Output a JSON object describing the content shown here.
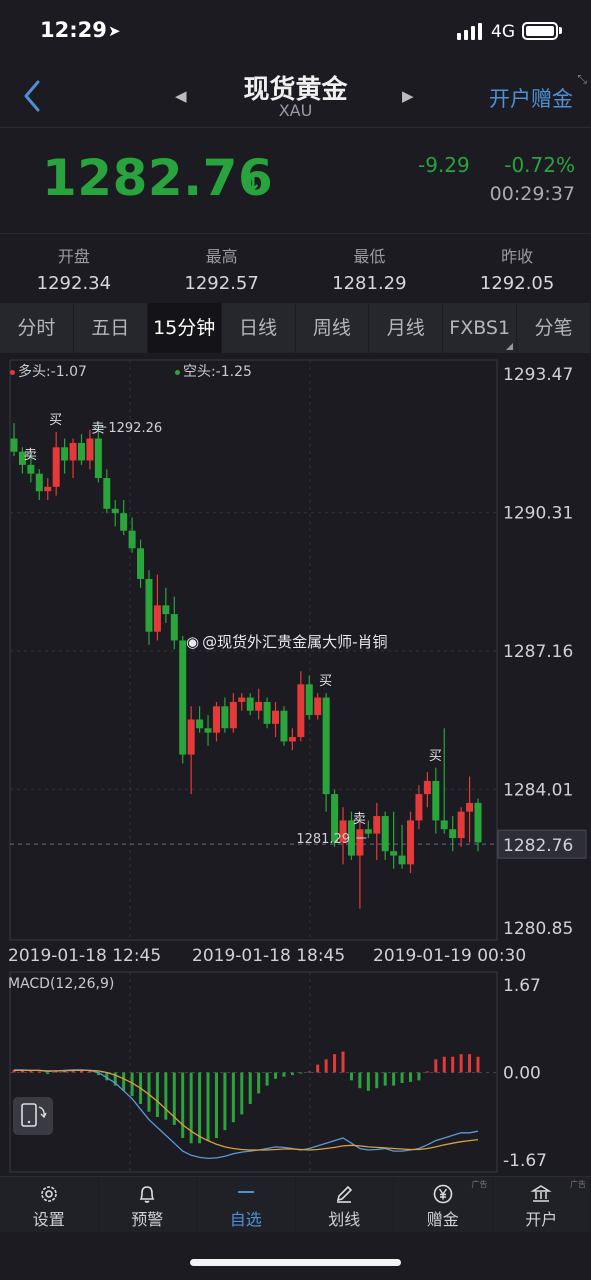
{
  "status_bar": {
    "time": "12:29",
    "network": "4G"
  },
  "header": {
    "title": "现货黄金",
    "subtitle": "XAU",
    "open_account": "开户赠金"
  },
  "quote": {
    "price": "1282.76",
    "change": "-9.29",
    "change_pct": "-0.72%",
    "time": "00:29:37"
  },
  "stats": [
    {
      "label": "开盘",
      "value": "1292.34"
    },
    {
      "label": "最高",
      "value": "1292.57"
    },
    {
      "label": "最低",
      "value": "1281.29"
    },
    {
      "label": "昨收",
      "value": "1292.05"
    }
  ],
  "tabs": [
    {
      "label": "分时",
      "active": false,
      "dropdown": false
    },
    {
      "label": "五日",
      "active": false,
      "dropdown": false
    },
    {
      "label": "15分钟",
      "active": true,
      "dropdown": false
    },
    {
      "label": "日线",
      "active": false,
      "dropdown": false
    },
    {
      "label": "周线",
      "active": false,
      "dropdown": false
    },
    {
      "label": "月线",
      "active": false,
      "dropdown": false
    },
    {
      "label": "FXBS1",
      "active": false,
      "dropdown": true
    },
    {
      "label": "分笔",
      "active": false,
      "dropdown": false
    }
  ],
  "legend": {
    "long": "多头:-1.07",
    "short": "空头:-1.25"
  },
  "watermark": "@现货外汇贵金属大师-肖铜",
  "macd_label": "MACD(12,26,9)",
  "bottom_bar": [
    {
      "label": "设置",
      "icon": "gear-icon",
      "active": false,
      "ad": false
    },
    {
      "label": "预警",
      "icon": "bell-icon",
      "active": false,
      "ad": false
    },
    {
      "label": "自选",
      "icon": "dash-icon",
      "active": true,
      "ad": false
    },
    {
      "label": "划线",
      "icon": "pen-icon",
      "active": false,
      "ad": false
    },
    {
      "label": "赠金",
      "icon": "yen-icon",
      "active": false,
      "ad": true
    },
    {
      "label": "开户",
      "icon": "bank-icon",
      "active": false,
      "ad": true
    }
  ],
  "ad_tag": "广告",
  "colors": {
    "up": "#e63a3a",
    "down": "#2aa53c",
    "accent": "#4e8fd6",
    "dif": "#5a9ad8",
    "dea": "#d8a040"
  },
  "chart_data": {
    "type": "candlestick",
    "y_ticks": [
      "1293.47",
      "1290.31",
      "1287.16",
      "1284.01",
      "1280.85"
    ],
    "ylim": [
      1280.85,
      1293.47
    ],
    "current_price": "1282.76",
    "x_labels": [
      "2019-01-18 12:45",
      "2019-01-18 18:45",
      "2019-01-19 00:30"
    ],
    "annotations": [
      {
        "text": "买",
        "index": 5
      },
      {
        "text": "卖",
        "index": 2
      },
      {
        "text": "卖",
        "index": 10
      },
      {
        "text": "1292.26",
        "index": 10
      },
      {
        "text": "买",
        "index": 37
      },
      {
        "text": "卖",
        "index": 41
      },
      {
        "text": "1281.29",
        "index": 42
      },
      {
        "text": "买",
        "index": 50
      }
    ],
    "candles": [
      [
        1292.0,
        1292.35,
        1291.6,
        1291.7
      ],
      [
        1291.7,
        1291.8,
        1291.2,
        1291.4
      ],
      [
        1291.4,
        1291.7,
        1291.0,
        1291.2
      ],
      [
        1291.2,
        1291.3,
        1290.6,
        1290.8
      ],
      [
        1290.8,
        1291.1,
        1290.6,
        1290.9
      ],
      [
        1290.9,
        1292.15,
        1290.7,
        1291.8
      ],
      [
        1291.8,
        1292.0,
        1291.2,
        1291.5
      ],
      [
        1291.5,
        1292.0,
        1291.1,
        1291.9
      ],
      [
        1291.9,
        1292.1,
        1291.4,
        1291.5
      ],
      [
        1291.5,
        1292.2,
        1291.3,
        1292.0
      ],
      [
        1292.0,
        1292.26,
        1291.0,
        1291.1
      ],
      [
        1291.1,
        1291.3,
        1290.3,
        1290.4
      ],
      [
        1290.4,
        1290.6,
        1290.0,
        1290.3
      ],
      [
        1290.3,
        1290.6,
        1289.8,
        1289.9
      ],
      [
        1289.9,
        1290.2,
        1289.4,
        1289.5
      ],
      [
        1289.5,
        1289.7,
        1288.6,
        1288.8
      ],
      [
        1288.8,
        1289.0,
        1287.3,
        1287.6
      ],
      [
        1287.6,
        1288.9,
        1287.4,
        1288.2
      ],
      [
        1288.2,
        1288.6,
        1287.8,
        1288.0
      ],
      [
        1288.0,
        1288.4,
        1287.2,
        1287.4
      ],
      [
        1287.4,
        1287.5,
        1284.6,
        1284.8
      ],
      [
        1284.8,
        1285.9,
        1283.9,
        1285.6
      ],
      [
        1285.6,
        1285.9,
        1285.3,
        1285.4
      ],
      [
        1285.4,
        1285.7,
        1285.0,
        1285.3
      ],
      [
        1285.3,
        1286.0,
        1285.1,
        1285.9
      ],
      [
        1285.9,
        1286.1,
        1285.3,
        1285.4
      ],
      [
        1285.4,
        1286.2,
        1285.3,
        1286.0
      ],
      [
        1286.0,
        1286.2,
        1285.8,
        1286.1
      ],
      [
        1286.1,
        1286.2,
        1285.7,
        1285.8
      ],
      [
        1285.8,
        1286.3,
        1285.6,
        1286.0
      ],
      [
        1286.0,
        1286.1,
        1285.4,
        1285.5
      ],
      [
        1285.5,
        1286.0,
        1285.2,
        1285.8
      ],
      [
        1285.8,
        1285.9,
        1285.0,
        1285.1
      ],
      [
        1285.1,
        1285.4,
        1284.9,
        1285.2
      ],
      [
        1285.2,
        1286.7,
        1285.1,
        1286.4
      ],
      [
        1286.4,
        1286.6,
        1285.6,
        1285.7
      ],
      [
        1285.7,
        1286.2,
        1285.6,
        1286.1
      ],
      [
        1286.1,
        1286.2,
        1283.5,
        1283.9
      ],
      [
        1283.9,
        1284.0,
        1282.7,
        1282.8
      ],
      [
        1282.8,
        1283.6,
        1282.3,
        1283.3
      ],
      [
        1283.3,
        1283.5,
        1282.4,
        1282.5
      ],
      [
        1282.5,
        1283.3,
        1281.29,
        1283.1
      ],
      [
        1283.1,
        1283.3,
        1282.9,
        1283.0
      ],
      [
        1283.0,
        1283.7,
        1282.4,
        1283.4
      ],
      [
        1283.4,
        1283.5,
        1282.4,
        1282.6
      ],
      [
        1282.6,
        1283.5,
        1282.2,
        1282.5
      ],
      [
        1282.5,
        1283.2,
        1282.2,
        1282.3
      ],
      [
        1282.3,
        1283.5,
        1282.1,
        1283.3
      ],
      [
        1283.3,
        1284.1,
        1283.1,
        1283.9
      ],
      [
        1283.9,
        1284.4,
        1283.6,
        1284.2
      ],
      [
        1284.2,
        1284.5,
        1283.0,
        1283.3
      ],
      [
        1283.3,
        1285.4,
        1283.0,
        1283.1
      ],
      [
        1283.1,
        1283.4,
        1282.6,
        1282.9
      ],
      [
        1282.9,
        1283.6,
        1282.7,
        1283.5
      ],
      [
        1283.5,
        1284.3,
        1282.8,
        1283.7
      ],
      [
        1283.7,
        1283.8,
        1282.6,
        1282.8
      ]
    ],
    "macd": {
      "y_ticks": [
        "1.67",
        "0.00",
        "-1.67"
      ],
      "ylim": [
        -1.67,
        1.67
      ],
      "hist": [
        0.05,
        0.04,
        0.03,
        0.02,
        -0.03,
        0.02,
        0.03,
        0.05,
        0.04,
        0.03,
        -0.05,
        -0.15,
        -0.25,
        -0.35,
        -0.45,
        -0.6,
        -0.75,
        -0.85,
        -0.9,
        -1.0,
        -1.25,
        -1.35,
        -1.35,
        -1.3,
        -1.25,
        -1.1,
        -0.95,
        -0.8,
        -0.6,
        -0.4,
        -0.25,
        -0.12,
        -0.08,
        -0.05,
        -0.02,
        0.02,
        0.15,
        0.25,
        0.35,
        0.4,
        -0.15,
        -0.3,
        -0.35,
        -0.3,
        -0.25,
        -0.25,
        -0.2,
        -0.18,
        -0.15,
        0.02,
        0.25,
        0.3,
        0.3,
        0.35,
        0.35,
        0.3
      ],
      "dif": [
        0.05,
        0.05,
        0.04,
        0.04,
        0.02,
        0.03,
        0.04,
        0.05,
        0.05,
        0.04,
        0.0,
        -0.1,
        -0.2,
        -0.35,
        -0.5,
        -0.7,
        -0.9,
        -1.05,
        -1.2,
        -1.35,
        -1.5,
        -1.58,
        -1.62,
        -1.64,
        -1.63,
        -1.6,
        -1.55,
        -1.52,
        -1.5,
        -1.48,
        -1.45,
        -1.42,
        -1.43,
        -1.45,
        -1.48,
        -1.45,
        -1.4,
        -1.35,
        -1.3,
        -1.25,
        -1.35,
        -1.45,
        -1.48,
        -1.47,
        -1.45,
        -1.5,
        -1.5,
        -1.48,
        -1.45,
        -1.38,
        -1.3,
        -1.25,
        -1.2,
        -1.15,
        -1.15,
        -1.12
      ],
      "dea": [
        0.04,
        0.04,
        0.04,
        0.04,
        0.03,
        0.03,
        0.03,
        0.04,
        0.04,
        0.04,
        0.03,
        0.0,
        -0.05,
        -0.12,
        -0.2,
        -0.3,
        -0.42,
        -0.55,
        -0.7,
        -0.85,
        -1.0,
        -1.12,
        -1.22,
        -1.3,
        -1.37,
        -1.42,
        -1.45,
        -1.47,
        -1.48,
        -1.48,
        -1.48,
        -1.47,
        -1.46,
        -1.46,
        -1.47,
        -1.48,
        -1.47,
        -1.45,
        -1.43,
        -1.4,
        -1.39,
        -1.4,
        -1.42,
        -1.43,
        -1.44,
        -1.45,
        -1.46,
        -1.47,
        -1.47,
        -1.45,
        -1.42,
        -1.38,
        -1.35,
        -1.32,
        -1.3,
        -1.28
      ]
    }
  }
}
